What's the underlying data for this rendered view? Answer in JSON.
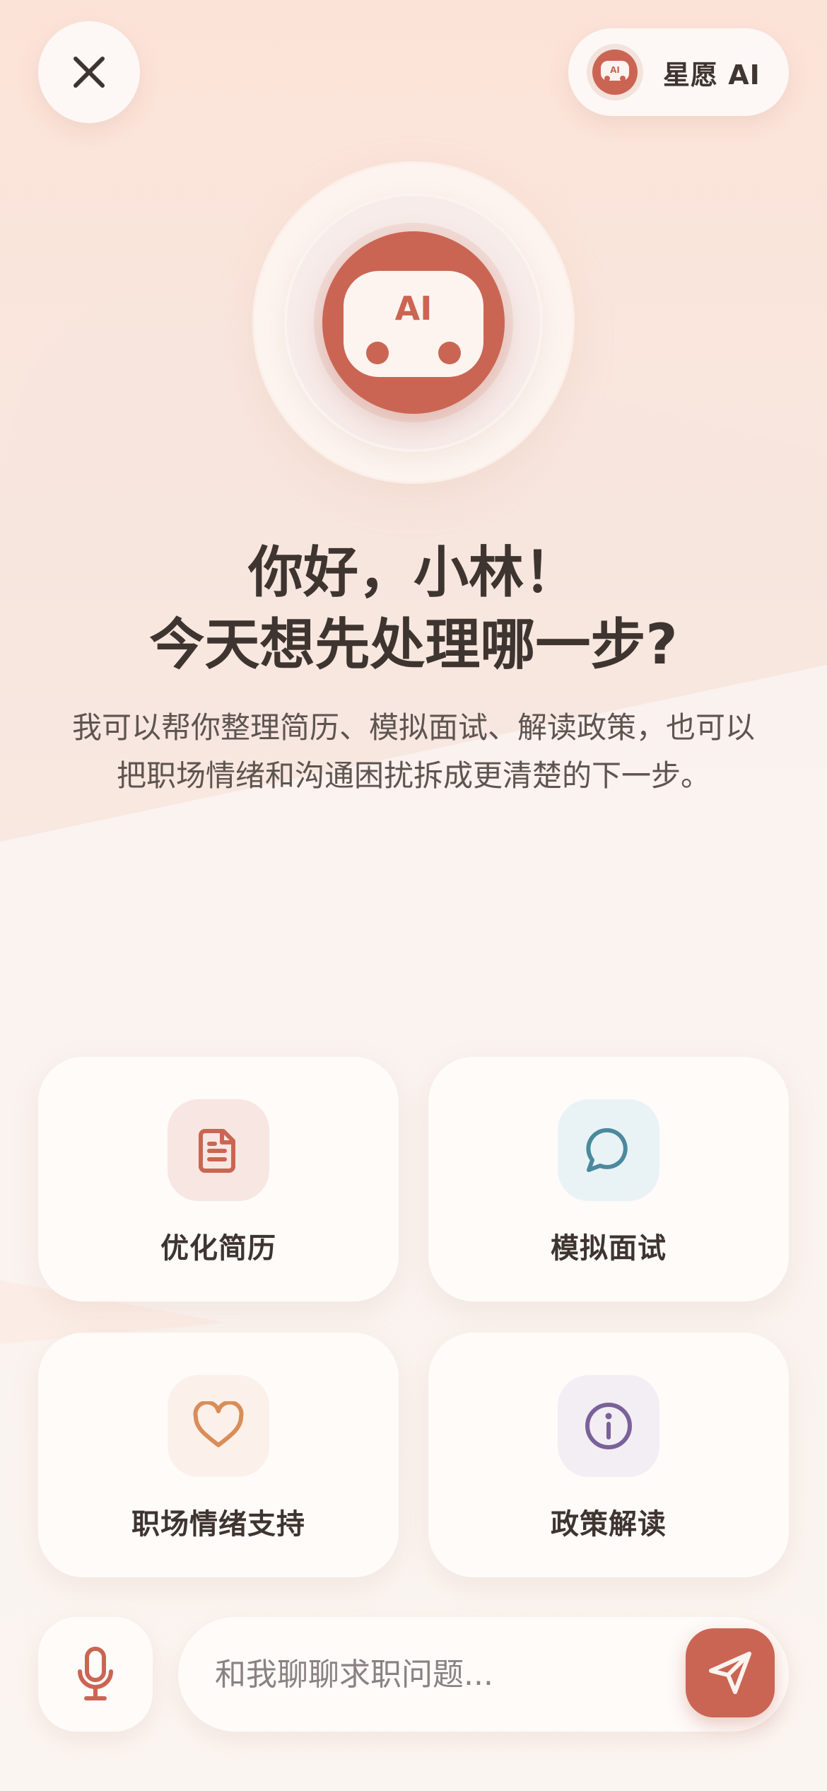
{
  "header": {
    "close_icon": "close-icon",
    "brand": {
      "avatar_text": "AI",
      "name": "星愿 AI"
    }
  },
  "hero": {
    "avatar_text": "AI",
    "greeting": "你好，小林！",
    "question": "今天想先处理哪一步?",
    "subtitle": "我可以帮你整理简历、模拟面试、解读政策，也可以把职场情绪和沟通困扰拆成更清楚的下一步。"
  },
  "actions": [
    {
      "label": "优化简历",
      "icon": "document-icon",
      "accent": "#cb6553",
      "bg": "#f8e6e2"
    },
    {
      "label": "模拟面试",
      "icon": "chat-bubble-icon",
      "accent": "#4a8a9c",
      "bg": "#e9f3f6"
    },
    {
      "label": "职场情绪支持",
      "icon": "heart-icon",
      "accent": "#d98d57",
      "bg": "#fbf0ea"
    },
    {
      "label": "政策解读",
      "icon": "info-icon",
      "accent": "#7a6199",
      "bg": "#f2eef3"
    }
  ],
  "composer": {
    "mic_icon": "microphone-icon",
    "placeholder": "和我聊聊求职问题...",
    "value": "",
    "send_icon": "send-icon"
  },
  "colors": {
    "brand": "#cb6553",
    "text_dark": "#3e3430",
    "text_muted": "#5e5450"
  }
}
